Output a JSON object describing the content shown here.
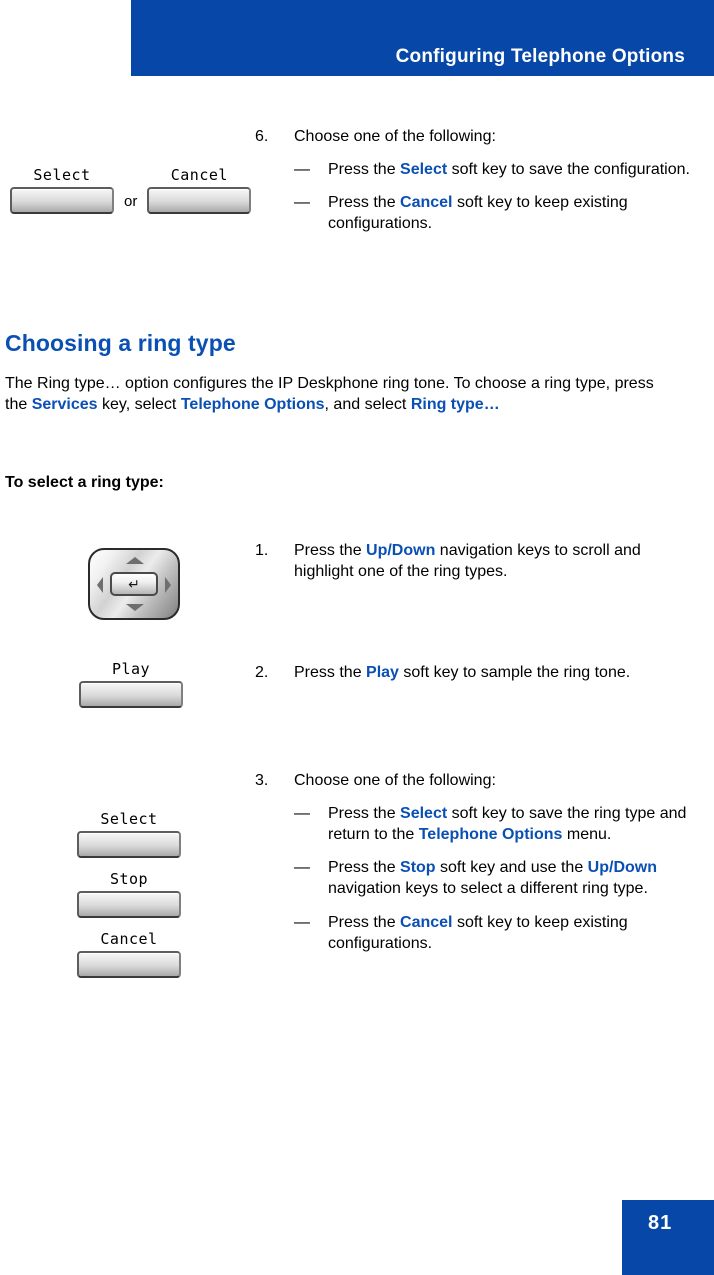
{
  "header": {
    "title": "Configuring Telephone Options",
    "banner_color": "#0647A8"
  },
  "footer": {
    "page_number": "81",
    "box_color": "#0647A8"
  },
  "accent_color": "#0A50B4",
  "top_step": {
    "number": "6.",
    "text": "Choose one of the following:",
    "substeps": [
      {
        "dash": "—",
        "pre": "Press the ",
        "keyword": "Select",
        "post": " soft key to save the configuration."
      },
      {
        "dash": "—",
        "pre": "Press the ",
        "keyword": "Cancel",
        "post": " soft key to keep existing configurations."
      }
    ],
    "softkeys": {
      "first_label": "Select",
      "conjunction": "or",
      "second_label": "Cancel"
    }
  },
  "section": {
    "heading": "Choosing a ring type",
    "paragraph": {
      "part1": "The Ring type… option configures the IP Deskphone ring tone. To choose a ring type, press the ",
      "kw1": "Services",
      "part2": " key, select ",
      "kw2": "Telephone Options",
      "part3": ", and select ",
      "kw3": "Ring type…"
    },
    "lead_in": "To select a ring type:"
  },
  "steps": [
    {
      "number": "1.",
      "pre": "Press the ",
      "keyword": "Up/Down",
      "post": " navigation keys to scroll and highlight one of the ring types.",
      "art": "navigation-pad",
      "enter_glyph": "↵"
    },
    {
      "number": "2.",
      "pre": "Press the ",
      "keyword": "Play",
      "post": " soft key to sample the ring tone.",
      "art": "softkey",
      "softkey_label": "Play"
    },
    {
      "number": "3.",
      "text": "Choose one of the following:",
      "art": "softkey-stack",
      "softkey_labels": [
        "Select",
        "Stop",
        "Cancel"
      ],
      "substeps": [
        {
          "dash": "—",
          "pre": "Press the ",
          "keyword": "Select",
          "mid": " soft key to save the ring type and return to the ",
          "keyword2": "Telephone Options",
          "post": " menu."
        },
        {
          "dash": "—",
          "pre": "Press the ",
          "keyword": "Stop",
          "mid": " soft key and use the ",
          "keyword2": "Up/Down",
          "post": " navigation keys to select a different ring type."
        },
        {
          "dash": "—",
          "pre": "Press the ",
          "keyword": "Cancel",
          "post": " soft key to keep existing configurations."
        }
      ]
    }
  ]
}
